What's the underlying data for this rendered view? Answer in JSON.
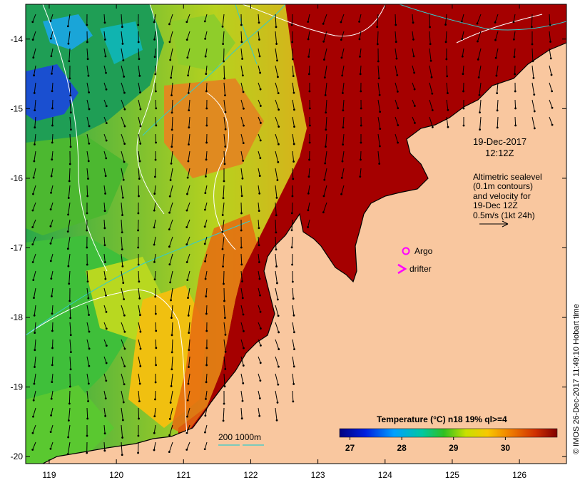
{
  "map": {
    "x_ticks": [
      "119",
      "120",
      "121",
      "122",
      "123",
      "124",
      "125",
      "126"
    ],
    "y_ticks": [
      "-14",
      "-15",
      "-16",
      "-17",
      "-18",
      "-19",
      "-20"
    ],
    "xlim": [
      118.65,
      126.7
    ],
    "ylim": [
      -20.1,
      -13.5
    ]
  },
  "annotations": {
    "date": "19-Dec-2017",
    "time": "12:12Z",
    "altimetry_lines": [
      "Altimetric sealevel",
      "(0.1m contours)",
      "and velocity for",
      "19-Dec 12Z",
      "0.5m/s (1kt 24h)"
    ]
  },
  "legend": {
    "argo_label": "Argo",
    "drifter_label": "drifter",
    "depth_label": "200  1000m"
  },
  "colorbar": {
    "title": "Temperature (°C) n18 19% ql>=4",
    "ticks": [
      "27",
      "28",
      "29",
      "30"
    ],
    "range": [
      26.8,
      31.0
    ]
  },
  "credit": "© IMOS 26-Dec-2017 11:49:10 Hobart time",
  "colors": {
    "land": "#f9c79f",
    "hot": "#a50000",
    "argo": "#ff00ff",
    "contour": "#ffffff",
    "isobath": "#33cccc"
  }
}
